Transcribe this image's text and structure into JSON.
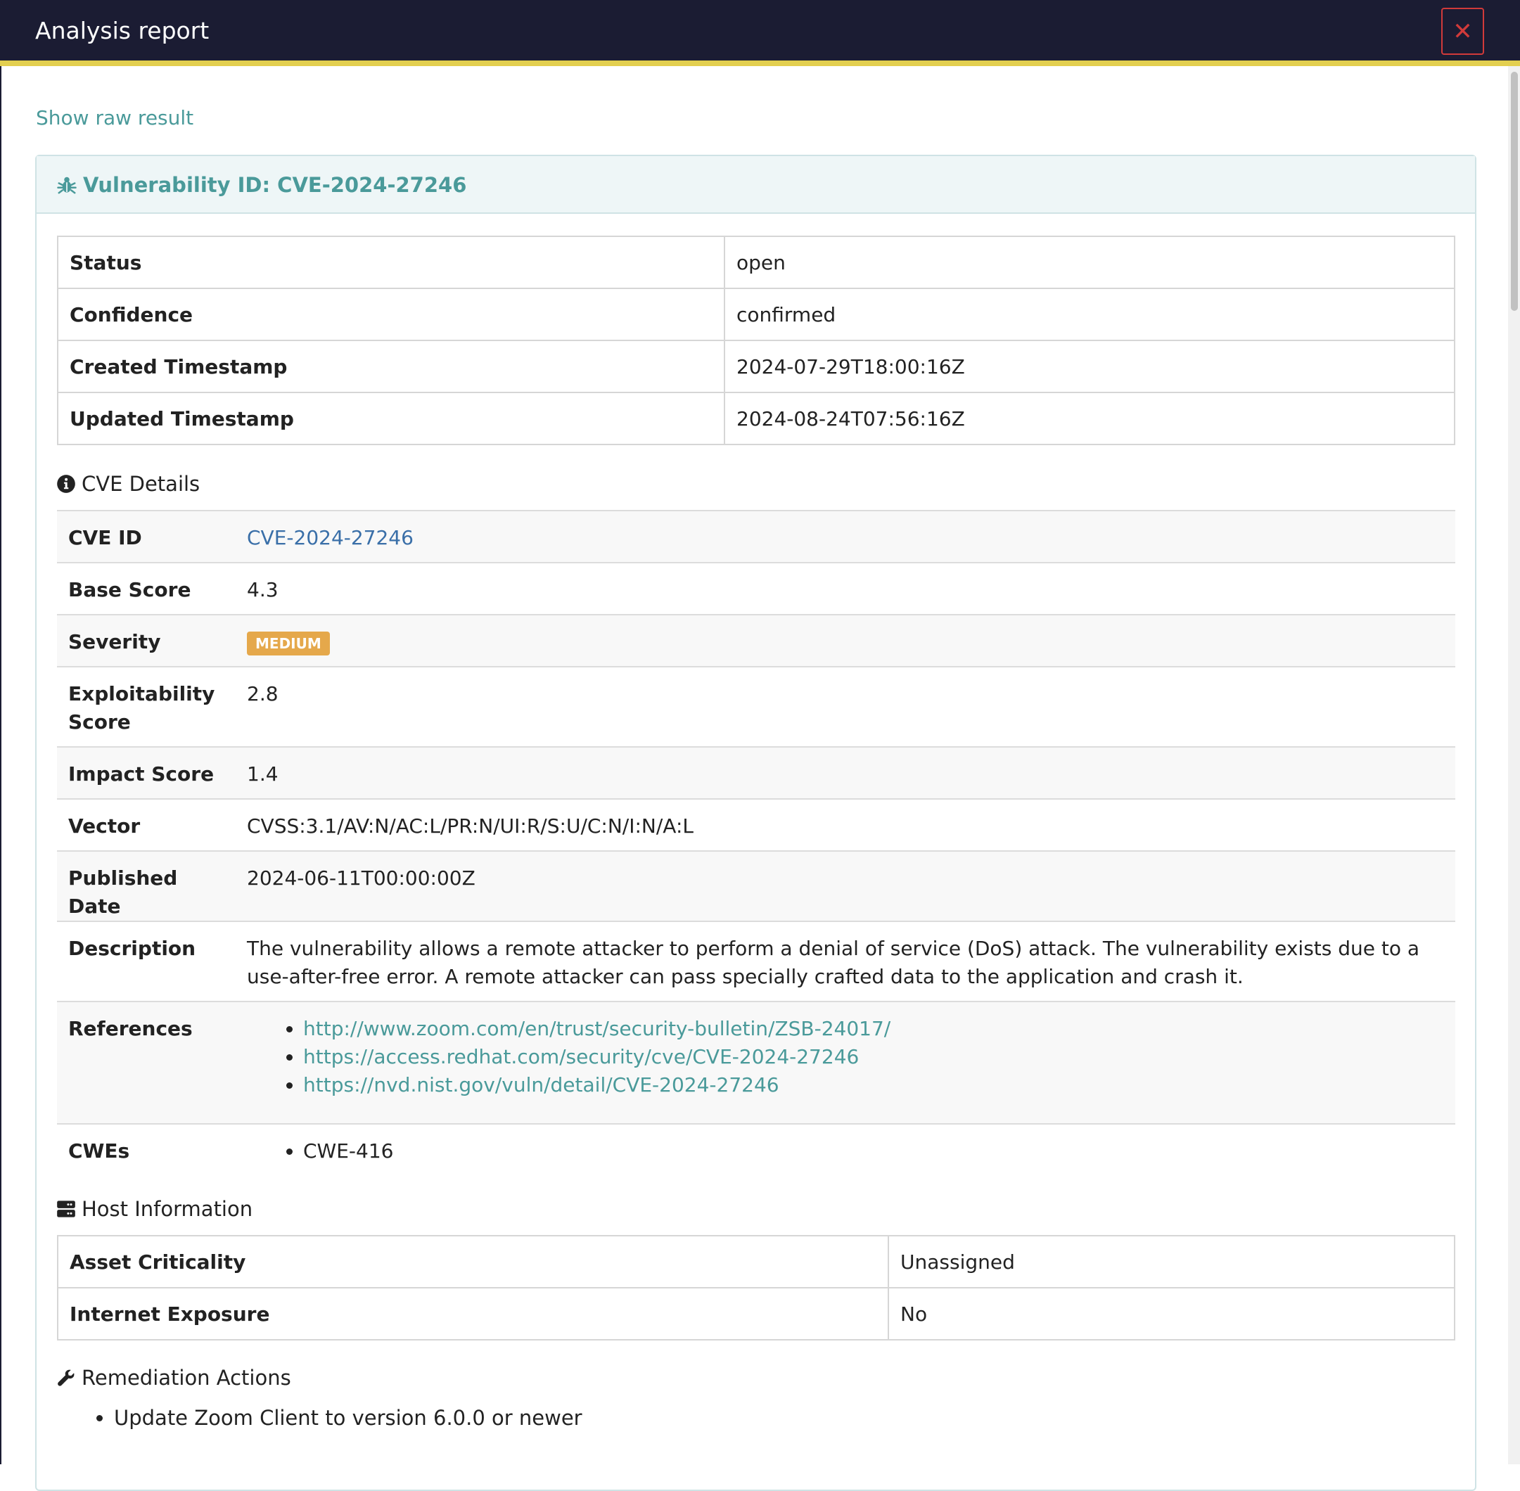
{
  "header": {
    "title": "Analysis report",
    "close_icon": "close-icon"
  },
  "raw_link": "Show raw result",
  "card": {
    "title": "Vulnerability ID: CVE-2024-27246",
    "icon": "bug-icon"
  },
  "status_table": [
    {
      "label": "Status",
      "value": "open"
    },
    {
      "label": "Confidence",
      "value": "confirmed"
    },
    {
      "label": "Created Timestamp",
      "value": "2024-07-29T18:00:16Z"
    },
    {
      "label": "Updated Timestamp",
      "value": "2024-08-24T07:56:16Z"
    }
  ],
  "cve_details": {
    "title": "CVE Details",
    "icon": "info-circle-icon",
    "rows": {
      "cve_id": {
        "label": "CVE ID",
        "value": "CVE-2024-27246"
      },
      "base_score": {
        "label": "Base Score",
        "value": "4.3"
      },
      "severity": {
        "label": "Severity",
        "value": "MEDIUM"
      },
      "exploitability": {
        "label": "Exploitability Score",
        "value": "2.8"
      },
      "impact": {
        "label": "Impact Score",
        "value": "1.4"
      },
      "vector": {
        "label": "Vector",
        "value": "CVSS:3.1/AV:N/AC:L/PR:N/UI:R/S:U/C:N/I:N/A:L"
      },
      "published": {
        "label": "Published Date",
        "value": "2024-06-11T00:00:00Z"
      },
      "description": {
        "label": "Description",
        "value": "The vulnerability allows a remote attacker to perform a denial of service (DoS) attack. The vulnerability exists due to a use-after-free error. A remote attacker can pass specially crafted data to the application and crash it."
      },
      "references": {
        "label": "References",
        "items": [
          "http://www.zoom.com/en/trust/security-bulletin/ZSB-24017/",
          "https://access.redhat.com/security/cve/CVE-2024-27246",
          "https://nvd.nist.gov/vuln/detail/CVE-2024-27246"
        ]
      },
      "cwes": {
        "label": "CWEs",
        "items": [
          "CWE-416"
        ]
      }
    }
  },
  "host_info": {
    "title": "Host Information",
    "icon": "server-icon",
    "rows": [
      {
        "label": "Asset Criticality",
        "value": "Unassigned"
      },
      {
        "label": "Internet Exposure",
        "value": "No"
      }
    ]
  },
  "remediation": {
    "title": "Remediation Actions",
    "icon": "wrench-icon",
    "items": [
      "Update Zoom Client to version 6.0.0 or newer"
    ]
  },
  "colors": {
    "header_bg": "#1b1c33",
    "accent_yellow": "#e3cf4f",
    "teal": "#4a9a9a",
    "severity_medium": "#e5a84b",
    "close_red": "#d13a3a"
  }
}
